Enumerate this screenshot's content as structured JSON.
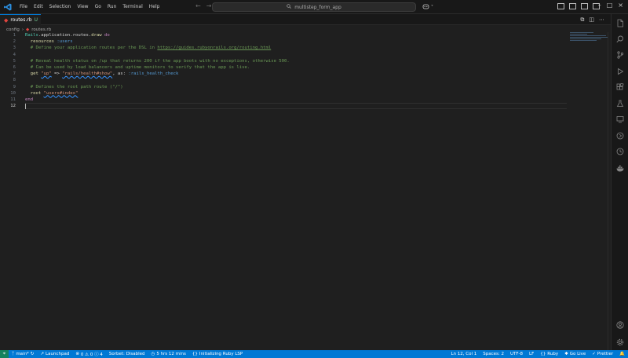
{
  "menubar": {
    "items": [
      "File",
      "Edit",
      "Selection",
      "View",
      "Go",
      "Run",
      "Terminal",
      "Help"
    ]
  },
  "command_center": {
    "label": "multistep_form_app"
  },
  "tab": {
    "filename": "routes.rb",
    "status": "U"
  },
  "breadcrumb": {
    "folder": "config",
    "file": "routes.rb"
  },
  "editor": {
    "line_numbers": [
      "1",
      "2",
      "3",
      "4",
      "5",
      "6",
      "7",
      "8",
      "9",
      "10",
      "11",
      "12"
    ],
    "line1": {
      "a": "Rails",
      "b": ".application.routes.",
      "c": "draw",
      "d": " do"
    },
    "line2": {
      "a": "  resources ",
      "b": ":users"
    },
    "line3": {
      "a": "  # Define your application routes per the DSL in ",
      "b": "https://guides.rubyonrails.org/routing.html"
    },
    "line5": "  # Reveal health status on /up that returns 200 if the app boots with no exceptions, otherwise 500.",
    "line6": "  # Can be used by load balancers and uptime monitors to verify that the app is live.",
    "line7": {
      "a": "  get ",
      "b": "\"up\"",
      "c": " => ",
      "d": "\"rails/health#show\"",
      "e": ", as: ",
      "f": ":rails_health_check"
    },
    "line9": "  # Defines the root path route (\"/\")",
    "line10": {
      "a": "  root ",
      "b": "\"users#index\""
    },
    "line11": "end"
  },
  "statusbar": {
    "branch": "main*",
    "launchpad": "Launchpad",
    "problems": "0 ⚠ 0 ⓘ 4",
    "sorbet": "Sorbet: Disabled",
    "time": "5 hrs 12 mins",
    "ruby_lsp": "Initializing Ruby LSP",
    "cursor": "Ln 12, Col 1",
    "spaces": "Spaces: 2",
    "encoding": "UTF-8",
    "eol": "LF",
    "language": "Ruby",
    "golive": "Go Live",
    "prettier": "Prettier"
  },
  "colors": {
    "accent": "#0078d4",
    "remote": "#16825d",
    "ruby": "#e0443e",
    "comment": "#6a9955",
    "string": "#ce9178"
  }
}
